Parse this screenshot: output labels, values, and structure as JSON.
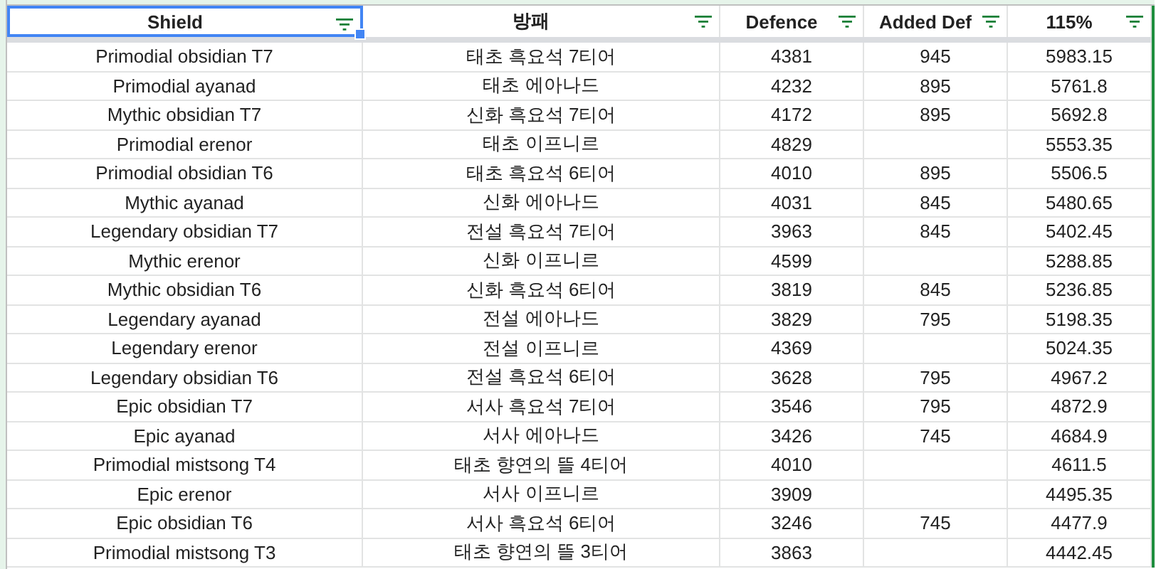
{
  "columns": [
    {
      "label": "Shield",
      "selected": true
    },
    {
      "label": "방패",
      "selected": false
    },
    {
      "label": "Defence",
      "selected": false
    },
    {
      "label": "Added Def",
      "selected": false
    },
    {
      "label": "115%",
      "selected": false
    }
  ],
  "rows": [
    {
      "shield": "Primodial obsidian T7",
      "shield_ko": "태초 흑요석 7티어",
      "defence": "4381",
      "added_def": "945",
      "value_115": "5983.15"
    },
    {
      "shield": "Primodial ayanad",
      "shield_ko": "태초 에아나드",
      "defence": "4232",
      "added_def": "895",
      "value_115": "5761.8"
    },
    {
      "shield": "Mythic obsidian T7",
      "shield_ko": "신화 흑요석 7티어",
      "defence": "4172",
      "added_def": "895",
      "value_115": "5692.8"
    },
    {
      "shield": "Primodial erenor",
      "shield_ko": "태초 이프니르",
      "defence": "4829",
      "value_115": "5553.35"
    },
    {
      "shield": "Primodial obsidian T6",
      "shield_ko": "태초 흑요석 6티어",
      "defence": "4010",
      "added_def": "895",
      "value_115": "5506.5"
    },
    {
      "shield": "Mythic ayanad",
      "shield_ko": "신화 에아나드",
      "defence": "4031",
      "added_def": "845",
      "value_115": "5480.65"
    },
    {
      "shield": "Legendary obsidian T7",
      "shield_ko": "전설 흑요석 7티어",
      "defence": "3963",
      "added_def": "845",
      "value_115": "5402.45"
    },
    {
      "shield": "Mythic erenor",
      "shield_ko": "신화 이프니르",
      "defence": "4599",
      "value_115": "5288.85"
    },
    {
      "shield": "Mythic obsidian T6",
      "shield_ko": "신화 흑요석 6티어",
      "defence": "3819",
      "added_def": "845",
      "value_115": "5236.85"
    },
    {
      "shield": "Legendary ayanad",
      "shield_ko": "전설 에아나드",
      "defence": "3829",
      "added_def": "795",
      "value_115": "5198.35"
    },
    {
      "shield": "Legendary erenor",
      "shield_ko": "전설 이프니르",
      "defence": "4369",
      "value_115": "5024.35"
    },
    {
      "shield": "Legendary obsidian T6",
      "shield_ko": "전설 흑요석 6티어",
      "defence": "3628",
      "added_def": "795",
      "value_115": "4967.2"
    },
    {
      "shield": "Epic obsidian T7",
      "shield_ko": "서사 흑요석 7티어",
      "defence": "3546",
      "added_def": "795",
      "value_115": "4872.9"
    },
    {
      "shield": "Epic ayanad",
      "shield_ko": "서사 에아나드",
      "defence": "3426",
      "added_def": "745",
      "value_115": "4684.9"
    },
    {
      "shield": "Primodial mistsong T4",
      "shield_ko": "태초 향연의 뜰 4티어",
      "defence": "4010",
      "value_115": "4611.5"
    },
    {
      "shield": "Epic erenor",
      "shield_ko": "서사 이프니르",
      "defence": "3909",
      "value_115": "4495.35"
    },
    {
      "shield": "Epic obsidian T6",
      "shield_ko": "서사 흑요석 6티어",
      "defence": "3246",
      "added_def": "745",
      "value_115": "4477.9"
    },
    {
      "shield": "Primodial mistsong T3",
      "shield_ko": "태초 향연의 뜰 3티어",
      "defence": "3863",
      "value_115": "4442.45"
    }
  ]
}
